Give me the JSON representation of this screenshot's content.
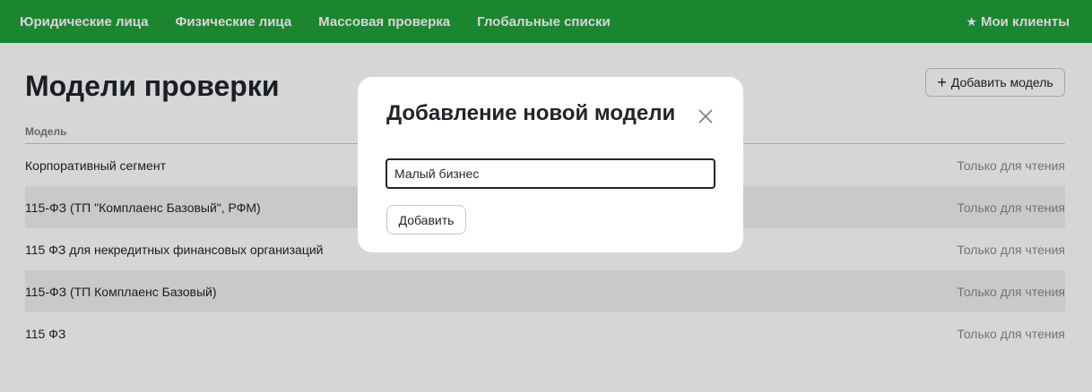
{
  "nav": {
    "items": [
      {
        "label": "Юридические лица"
      },
      {
        "label": "Физические лица"
      },
      {
        "label": "Массовая проверка"
      },
      {
        "label": "Глобальные списки"
      }
    ],
    "clients_label": "Мои клиенты",
    "clients_icon": "star-icon",
    "brand_color": "#21a038"
  },
  "page": {
    "title": "Модели проверки",
    "add_button_label": "Добавить модель",
    "add_button_icon": "plus-icon",
    "column_header": "Модель",
    "rows": [
      {
        "name": "Корпоративный сегмент",
        "access": "Только для чтения"
      },
      {
        "name": "115-ФЗ (ТП \"Комплаенс Базовый\", РФМ)",
        "access": "Только для чтения"
      },
      {
        "name": "115 ФЗ для некредитных финансовых организаций",
        "access": "Только для чтения"
      },
      {
        "name": "115-ФЗ (ТП Комплаенс Базовый)",
        "access": "Только для чтения"
      },
      {
        "name": "115 ФЗ",
        "access": "Только для чтения"
      }
    ]
  },
  "modal": {
    "title": "Добавление новой модели",
    "input_value": "Малый бизнес",
    "submit_label": "Добавить",
    "close_icon": "close-icon"
  }
}
